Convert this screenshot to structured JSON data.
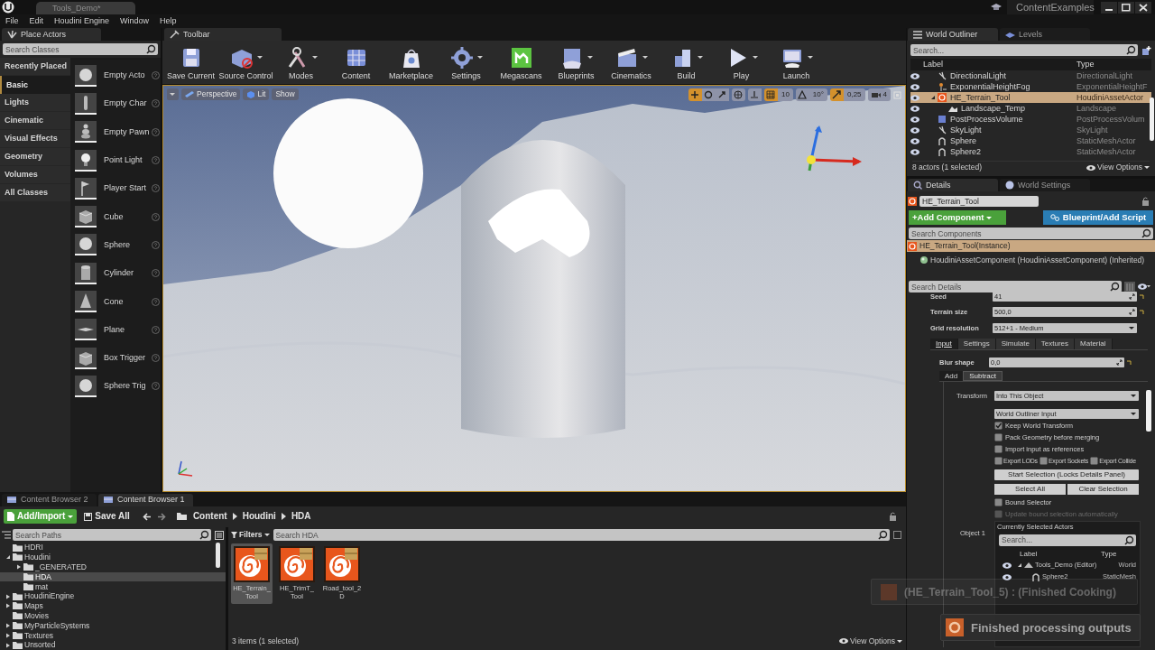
{
  "title_bar": {
    "document_tab": "Tools_Demo*",
    "project": "ContentExamples"
  },
  "menu": [
    "File",
    "Edit",
    "Houdini Engine",
    "Window",
    "Help"
  ],
  "place_actors": {
    "tab": "Place Actors",
    "search_placeholder": "Search Classes",
    "categories": [
      {
        "label": "Recently Placed",
        "selected": false
      },
      {
        "label": "Basic",
        "selected": true
      },
      {
        "label": "Lights",
        "selected": false
      },
      {
        "label": "Cinematic",
        "selected": false
      },
      {
        "label": "Visual Effects",
        "selected": false
      },
      {
        "label": "Geometry",
        "selected": false
      },
      {
        "label": "Volumes",
        "selected": false
      },
      {
        "label": "All Classes",
        "selected": false
      }
    ],
    "items": [
      {
        "label": "Empty Acto",
        "kind": "sphere"
      },
      {
        "label": "Empty Char",
        "kind": "figure"
      },
      {
        "label": "Empty Pawn",
        "kind": "pawn"
      },
      {
        "label": "Point Light",
        "kind": "light"
      },
      {
        "label": "Player Start",
        "kind": "flag"
      },
      {
        "label": "Cube",
        "kind": "cube"
      },
      {
        "label": "Sphere",
        "kind": "sphere"
      },
      {
        "label": "Cylinder",
        "kind": "cylinder"
      },
      {
        "label": "Cone",
        "kind": "cone"
      },
      {
        "label": "Plane",
        "kind": "plane"
      },
      {
        "label": "Box Trigger",
        "kind": "cube"
      },
      {
        "label": "Sphere Trig",
        "kind": "sphere"
      }
    ]
  },
  "toolbar": {
    "tab": "Toolbar",
    "buttons": [
      {
        "label": "Save Current",
        "kind": "save",
        "dropdown": false
      },
      {
        "label": "Source Control",
        "kind": "source",
        "dropdown": true
      },
      {
        "label": "Modes",
        "kind": "modes",
        "dropdown": true
      },
      {
        "label": "Content",
        "kind": "content",
        "dropdown": false
      },
      {
        "label": "Marketplace",
        "kind": "market",
        "dropdown": false
      },
      {
        "label": "Settings",
        "kind": "settings",
        "dropdown": true
      },
      {
        "label": "Megascans",
        "kind": "megascans",
        "dropdown": false
      },
      {
        "label": "Blueprints",
        "kind": "blueprints",
        "dropdown": true
      },
      {
        "label": "Cinematics",
        "kind": "cinematics",
        "dropdown": true
      },
      {
        "label": "Build",
        "kind": "build",
        "dropdown": true
      },
      {
        "label": "Play",
        "kind": "play",
        "dropdown": true
      },
      {
        "label": "Launch",
        "kind": "launch",
        "dropdown": true
      }
    ]
  },
  "viewport": {
    "buttons": [
      {
        "label": "Perspective",
        "kind": "camera"
      },
      {
        "label": "Lit",
        "kind": "lit"
      },
      {
        "label": "Show",
        "kind": "plain"
      }
    ],
    "transform_modes": [
      {
        "kind": "translate",
        "selected": true
      },
      {
        "kind": "rotate",
        "selected": false
      },
      {
        "kind": "scale",
        "selected": false
      }
    ],
    "snaps": [
      {
        "kind": "grid",
        "value": "10",
        "on": true
      },
      {
        "kind": "rotation",
        "value": "10°",
        "on": false
      },
      {
        "kind": "scale",
        "value": "0,25",
        "on": true
      }
    ],
    "camera_speed": "4"
  },
  "outliner": {
    "tabs": [
      {
        "label": "World Outliner",
        "kind": "list",
        "selected": true
      },
      {
        "label": "Levels",
        "kind": "levels",
        "selected": false
      }
    ],
    "search_placeholder": "Search...",
    "columns": [
      "Label",
      "Type"
    ],
    "rows": [
      {
        "label": "DirectionalLight",
        "type": "DirectionalLight",
        "kind": "light",
        "selected": false
      },
      {
        "label": "ExponentialHeightFog",
        "type": "ExponentialHeightF",
        "kind": "fog",
        "selected": false
      },
      {
        "label": "HE_Terrain_Tool",
        "type": "HoudiniAssetActor",
        "kind": "houdini",
        "selected": true,
        "expanded": true,
        "children": [
          {
            "label": "Landscape_Temp",
            "type": "Landscape",
            "kind": "landscape",
            "selected": false
          }
        ]
      },
      {
        "label": "PostProcessVolume",
        "type": "PostProcessVolum",
        "kind": "volume",
        "selected": false
      },
      {
        "label": "SkyLight",
        "type": "SkyLight",
        "kind": "light",
        "selected": false
      },
      {
        "label": "Sphere",
        "type": "StaticMeshActor",
        "kind": "mesh",
        "selected": false
      },
      {
        "label": "Sphere2",
        "type": "StaticMeshActor",
        "kind": "mesh",
        "selected": false
      }
    ],
    "status": "8 actors (1 selected)",
    "view_options": "View Options"
  },
  "details": {
    "tabs": [
      {
        "label": "Details",
        "kind": "details",
        "selected": true
      },
      {
        "label": "World Settings",
        "kind": "world",
        "selected": false
      }
    ],
    "actor_name": "HE_Terrain_Tool",
    "add_component": "+Add Component",
    "blueprint_button": "Blueprint/Add Script",
    "components_search_placeholder": "Search Components",
    "components": [
      {
        "label": "HE_Terrain_Tool(Instance)",
        "selected": true,
        "children": [
          {
            "label": "HoudiniAssetComponent (HoudiniAssetComponent) (Inherited)",
            "selected": false
          }
        ]
      }
    ],
    "details_search_placeholder": "Search Details",
    "properties": [
      {
        "label": "Seed",
        "value": "41",
        "kind": "number"
      },
      {
        "label": "Terrain size",
        "value": "500,0",
        "kind": "number"
      },
      {
        "label": "Grid resolution",
        "value": "512+1 - Medium",
        "kind": "dropdown"
      }
    ],
    "input_tabs": [
      {
        "label": "Input",
        "selected": true
      },
      {
        "label": "Settings",
        "selected": false
      },
      {
        "label": "Simulate",
        "selected": false
      },
      {
        "label": "Textures",
        "selected": false
      },
      {
        "label": "Material",
        "selected": false
      }
    ],
    "blur_shape": {
      "label": "Blur shape",
      "value": "0,0"
    },
    "mode_tabs": [
      {
        "label": "Add",
        "selected": false
      },
      {
        "label": "Subtract",
        "selected": true
      }
    ],
    "transform": {
      "label": "Transform",
      "value": "Into This Object"
    },
    "input_type": "World Outliner Input",
    "options": [
      {
        "label": "Keep World Transform",
        "checked": true,
        "disabled": false
      },
      {
        "label": "Pack Geometry before merging",
        "checked": false,
        "disabled": false
      },
      {
        "label": "Import input as references",
        "checked": false,
        "disabled": false
      }
    ],
    "export_options": [
      {
        "label": "Export LODs",
        "checked": false
      },
      {
        "label": "Export Sockets",
        "checked": false
      },
      {
        "label": "Export Collide",
        "checked": false
      }
    ],
    "start_selection": "Start Selection (Locks Details Panel)",
    "select_all": "Select All",
    "clear_selection": "Clear Selection",
    "bound_options": [
      {
        "label": "Bound Selector",
        "checked": false,
        "disabled": false
      },
      {
        "label": "Update bound selection automatically",
        "checked": false,
        "disabled": true
      }
    ],
    "object_label": "Object 1",
    "selected_actors": {
      "title": "Currently Selected Actors",
      "search_placeholder": "Search...",
      "columns": [
        "Label",
        "Type"
      ],
      "rows": [
        {
          "label": "Tools_Demo (Editor)",
          "type": "World",
          "kind": "world",
          "expanded": true,
          "children": [
            {
              "label": "Sphere2",
              "type": "StaticMesh",
              "kind": "mesh"
            }
          ]
        }
      ]
    }
  },
  "content_browser": {
    "tabs": [
      {
        "label": "Content Browser 2",
        "selected": false
      },
      {
        "label": "Content Browser 1",
        "selected": true
      }
    ],
    "add_import": "Add/Import",
    "save_all": "Save All",
    "path": [
      "Content",
      "Houdini",
      "HDA"
    ],
    "search_paths_placeholder": "Search Paths",
    "folders": [
      {
        "label": "HDRI",
        "selected": false,
        "expandable": false
      },
      {
        "label": "Houdini",
        "selected": false,
        "expandable": true,
        "expanded": true,
        "children": [
          {
            "label": "_GENERATED",
            "selected": false,
            "expandable": true,
            "expanded": false
          },
          {
            "label": "HDA",
            "selected": true,
            "expandable": false
          },
          {
            "label": "mat",
            "selected": false,
            "expandable": false
          }
        ]
      },
      {
        "label": "HoudiniEngine",
        "selected": false,
        "expandable": true,
        "expanded": false
      },
      {
        "label": "Maps",
        "selected": false,
        "expandable": true,
        "expanded": false
      },
      {
        "label": "Movies",
        "selected": false,
        "expandable": false
      },
      {
        "label": "MyParticleSystems",
        "selected": false,
        "expandable": true,
        "expanded": false
      },
      {
        "label": "Textures",
        "selected": false,
        "expandable": true,
        "expanded": false
      },
      {
        "label": "Unsorted",
        "selected": false,
        "expandable": true,
        "expanded": false
      }
    ],
    "filters": "Filters",
    "search_placeholder": "Search HDA",
    "assets": [
      {
        "label": "HE_Terrain_ Tool",
        "selected": true
      },
      {
        "label": "HE_TrimT_ Tool",
        "selected": false
      },
      {
        "label": "Road_tool_2D",
        "selected": false
      }
    ],
    "status": "3 items (1 selected)",
    "view_options": "View Options"
  },
  "notifications": [
    {
      "text": "(HE_Terrain_Tool_5) : (Finished Cooking)",
      "kind": "fading"
    },
    {
      "text": "Finished processing outputs",
      "kind": "toast"
    }
  ]
}
